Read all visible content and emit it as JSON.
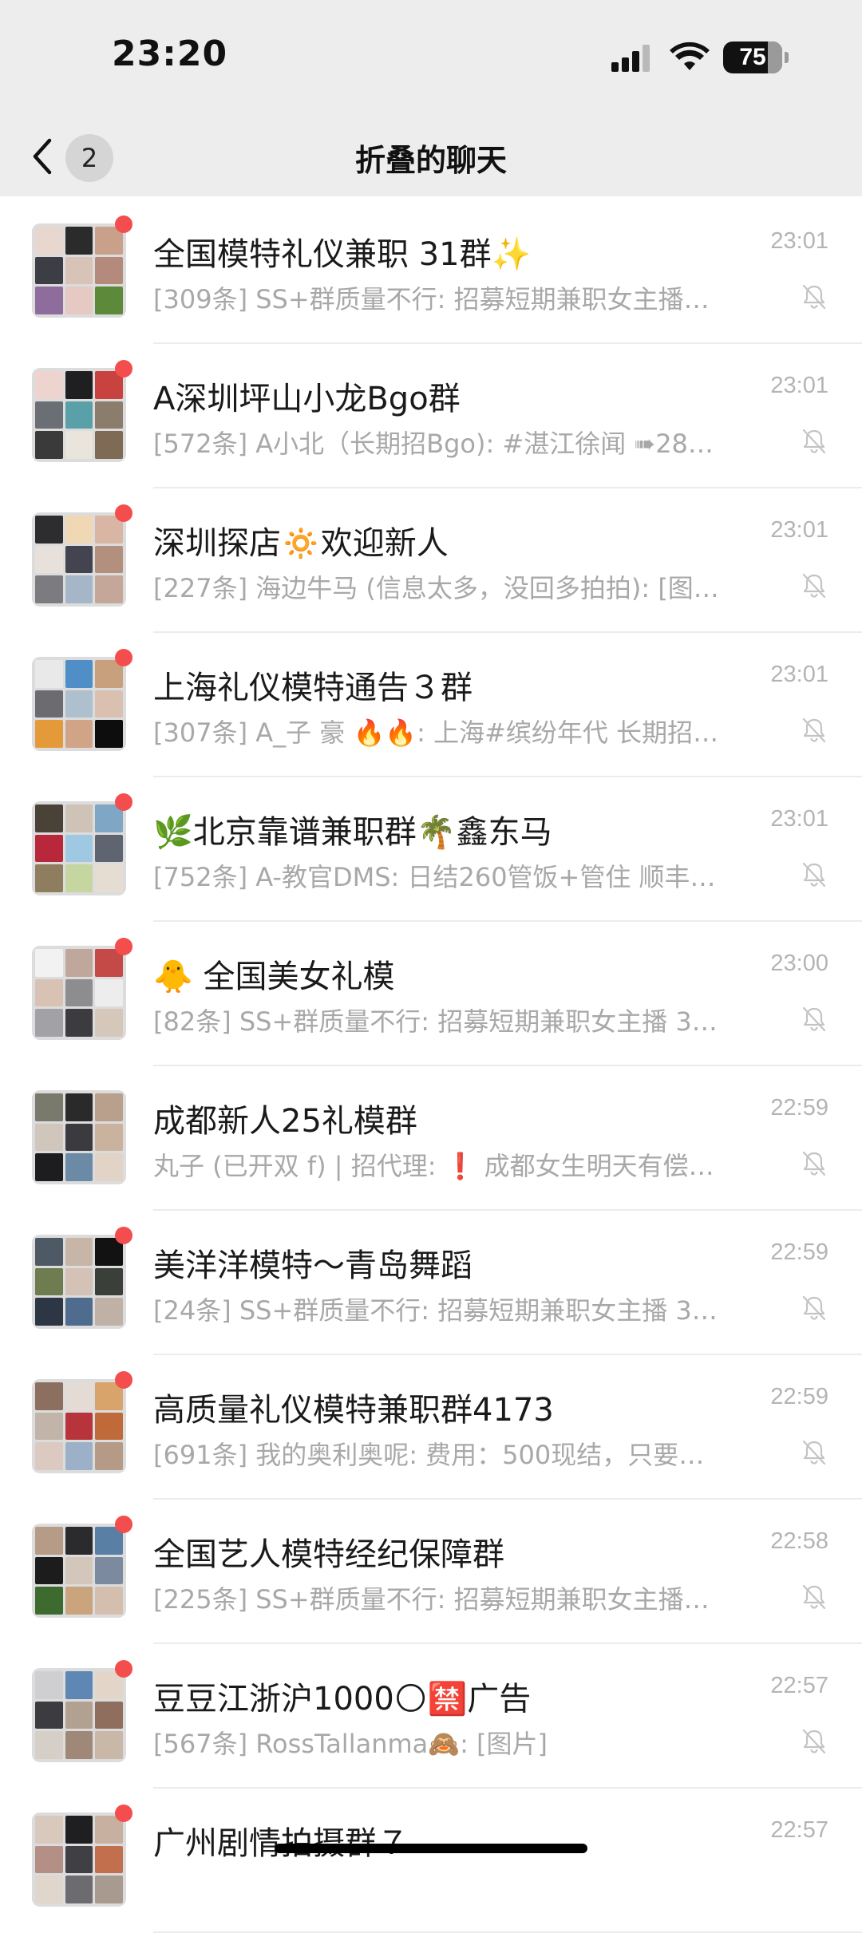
{
  "status_bar": {
    "time": "23:20",
    "battery_level": "75",
    "battery_fraction": 0.75
  },
  "nav": {
    "back_count": "2",
    "title": "折叠的聊天"
  },
  "colors": {
    "unread_dot": "#f44d4d",
    "nav_background": "#ededed",
    "secondary_text": "#a8a8a8"
  },
  "chats": [
    {
      "name": "全国模特礼仪兼职 31群✨",
      "time": "23:01",
      "preview": "[309条] SS+群质量不行: 招募短期兼职女主播…",
      "unread": true,
      "muted": true,
      "avatar_colors": [
        "#e8d7cf",
        "#2b2b2b",
        "#c9a08a",
        "#3d3d45",
        "#d8c3b8",
        "#b38a7c",
        "#8e6d9c",
        "#e7c9c4",
        "#5c8a3a"
      ]
    },
    {
      "name": "A深圳坪山小龙Bgo群",
      "time": "23:01",
      "preview": "[572条] A小北（长期招Bgo): #湛江徐闻 ➠28…",
      "unread": true,
      "muted": true,
      "avatar_colors": [
        "#eed4cf",
        "#1f1f22",
        "#c8433f",
        "#6a6e75",
        "#5aa0a8",
        "#8b7c6b",
        "#3a3a3a",
        "#e9e4dc",
        "#7f6a55"
      ]
    },
    {
      "name": "深圳探店🔅欢迎新人",
      "time": "23:01",
      "preview": "[227条] 海边牛马 (信息太多，没回多拍拍): [图…",
      "unread": true,
      "muted": true,
      "avatar_colors": [
        "#2d2d30",
        "#f1d8b4",
        "#d9b6a3",
        "#e8e0da",
        "#444450",
        "#b38f7e",
        "#7b7b80",
        "#a6b6c9",
        "#c5a79a"
      ]
    },
    {
      "name": "上海礼仪模特通告３群",
      "time": "23:01",
      "preview": "[307条] A_子 豪 🔥🔥: 上海#缤纷年代 长期招…",
      "unread": true,
      "muted": true,
      "avatar_colors": [
        "#e9e9e9",
        "#4f8ec7",
        "#c8a07d",
        "#6b6b70",
        "#aebfcd",
        "#d9c0b0",
        "#e59a3a",
        "#d2a487",
        "#0d0d0d"
      ]
    },
    {
      "name": "🌿北京靠谱兼职群🌴鑫东马",
      "time": "23:01",
      "preview": "[752条] A-教官DMS: 日结260管饭+管住 顺丰…",
      "unread": true,
      "muted": true,
      "avatar_colors": [
        "#4a4236",
        "#cfc3b8",
        "#7fa6c4",
        "#b8283a",
        "#9fc9e2",
        "#5e6470",
        "#8f7d60",
        "#c6d6a1",
        "#e6ddd2"
      ]
    },
    {
      "name": "🐥 全国美女礼模",
      "time": "23:00",
      "preview": "[82条] SS+群质量不行: 招募短期兼职女主播 3…",
      "unread": true,
      "muted": true,
      "avatar_colors": [
        "#f2f2f2",
        "#bfa79b",
        "#c44a48",
        "#d8c2b4",
        "#8d8d90",
        "#ededed",
        "#a1a1a6",
        "#3c3c40",
        "#d6c7bb"
      ]
    },
    {
      "name": "成都新人25礼模群",
      "time": "22:59",
      "preview": "丸子 (已开双 f) |  招代理: ❗ 成都女生明天有偿…",
      "unread": false,
      "muted": true,
      "avatar_colors": [
        "#7a7a6c",
        "#2a2a2a",
        "#b9a08c",
        "#d0c6bc",
        "#3b3b3f",
        "#c9b39f",
        "#1d1d20",
        "#6b8aa6",
        "#e1d3c6"
      ]
    },
    {
      "name": "美洋洋模特～青岛舞蹈",
      "time": "22:59",
      "preview": "[24条] SS+群质量不行: 招募短期兼职女主播 3…",
      "unread": true,
      "muted": true,
      "avatar_colors": [
        "#4d5a66",
        "#c7b6a8",
        "#121212",
        "#6e7c4f",
        "#d4c2b6",
        "#3a3f3a",
        "#2d3645",
        "#4f6b8d",
        "#bfb1a6"
      ]
    },
    {
      "name": "高质量礼仪模特兼职群4173",
      "time": "22:59",
      "preview": "[691条] 我的奥利奥呢: 费用：500现结，只要…",
      "unread": true,
      "muted": true,
      "avatar_colors": [
        "#8c6f5e",
        "#e4dcd4",
        "#d8a46b",
        "#c2b4a8",
        "#b8343c",
        "#c06a3a",
        "#dccac0",
        "#9cb1c7",
        "#b69a88"
      ]
    },
    {
      "name": "全国艺人模特经纪保障群",
      "time": "22:58",
      "preview": "[225条] SS+群质量不行: 招募短期兼职女主播…",
      "unread": true,
      "muted": true,
      "avatar_colors": [
        "#b69b87",
        "#2b2b2e",
        "#5a7fa5",
        "#1c1c1c",
        "#d3c7bb",
        "#7c8aa0",
        "#3d6b2f",
        "#c9a47c",
        "#d4bfae"
      ]
    },
    {
      "name": "豆豆江浙沪1000🌕🈲广告",
      "time": "22:57",
      "preview": "[567条] RossTallanma🙈: [图片]",
      "unread": true,
      "muted": true,
      "avatar_colors": [
        "#cfcfd2",
        "#5e87b3",
        "#e3d6c9",
        "#3c3c40",
        "#b2a090",
        "#8f6e5d",
        "#d6cfc8",
        "#a08878",
        "#c9b7a8"
      ]
    },
    {
      "name": "广州剧情拍摄群７",
      "time": "22:57",
      "preview": "",
      "unread": true,
      "muted": false,
      "avatar_colors": [
        "#d9c9bd",
        "#1f1f22",
        "#c7b0a0",
        "#b38f86",
        "#3f3f44",
        "#c26f4d",
        "#e0d6cc",
        "#6b6b70",
        "#a89a8e"
      ]
    }
  ]
}
